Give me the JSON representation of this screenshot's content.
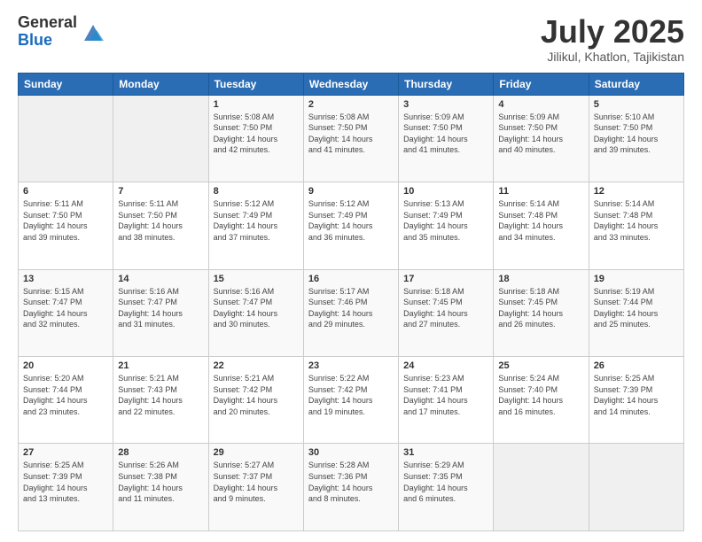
{
  "logo": {
    "general": "General",
    "blue": "Blue"
  },
  "title": "July 2025",
  "location": "Jilikul, Khatlon, Tajikistan",
  "days_header": [
    "Sunday",
    "Monday",
    "Tuesday",
    "Wednesday",
    "Thursday",
    "Friday",
    "Saturday"
  ],
  "weeks": [
    [
      {
        "day": "",
        "info": ""
      },
      {
        "day": "",
        "info": ""
      },
      {
        "day": "1",
        "info": "Sunrise: 5:08 AM\nSunset: 7:50 PM\nDaylight: 14 hours\nand 42 minutes."
      },
      {
        "day": "2",
        "info": "Sunrise: 5:08 AM\nSunset: 7:50 PM\nDaylight: 14 hours\nand 41 minutes."
      },
      {
        "day": "3",
        "info": "Sunrise: 5:09 AM\nSunset: 7:50 PM\nDaylight: 14 hours\nand 41 minutes."
      },
      {
        "day": "4",
        "info": "Sunrise: 5:09 AM\nSunset: 7:50 PM\nDaylight: 14 hours\nand 40 minutes."
      },
      {
        "day": "5",
        "info": "Sunrise: 5:10 AM\nSunset: 7:50 PM\nDaylight: 14 hours\nand 39 minutes."
      }
    ],
    [
      {
        "day": "6",
        "info": "Sunrise: 5:11 AM\nSunset: 7:50 PM\nDaylight: 14 hours\nand 39 minutes."
      },
      {
        "day": "7",
        "info": "Sunrise: 5:11 AM\nSunset: 7:50 PM\nDaylight: 14 hours\nand 38 minutes."
      },
      {
        "day": "8",
        "info": "Sunrise: 5:12 AM\nSunset: 7:49 PM\nDaylight: 14 hours\nand 37 minutes."
      },
      {
        "day": "9",
        "info": "Sunrise: 5:12 AM\nSunset: 7:49 PM\nDaylight: 14 hours\nand 36 minutes."
      },
      {
        "day": "10",
        "info": "Sunrise: 5:13 AM\nSunset: 7:49 PM\nDaylight: 14 hours\nand 35 minutes."
      },
      {
        "day": "11",
        "info": "Sunrise: 5:14 AM\nSunset: 7:48 PM\nDaylight: 14 hours\nand 34 minutes."
      },
      {
        "day": "12",
        "info": "Sunrise: 5:14 AM\nSunset: 7:48 PM\nDaylight: 14 hours\nand 33 minutes."
      }
    ],
    [
      {
        "day": "13",
        "info": "Sunrise: 5:15 AM\nSunset: 7:47 PM\nDaylight: 14 hours\nand 32 minutes."
      },
      {
        "day": "14",
        "info": "Sunrise: 5:16 AM\nSunset: 7:47 PM\nDaylight: 14 hours\nand 31 minutes."
      },
      {
        "day": "15",
        "info": "Sunrise: 5:16 AM\nSunset: 7:47 PM\nDaylight: 14 hours\nand 30 minutes."
      },
      {
        "day": "16",
        "info": "Sunrise: 5:17 AM\nSunset: 7:46 PM\nDaylight: 14 hours\nand 29 minutes."
      },
      {
        "day": "17",
        "info": "Sunrise: 5:18 AM\nSunset: 7:45 PM\nDaylight: 14 hours\nand 27 minutes."
      },
      {
        "day": "18",
        "info": "Sunrise: 5:18 AM\nSunset: 7:45 PM\nDaylight: 14 hours\nand 26 minutes."
      },
      {
        "day": "19",
        "info": "Sunrise: 5:19 AM\nSunset: 7:44 PM\nDaylight: 14 hours\nand 25 minutes."
      }
    ],
    [
      {
        "day": "20",
        "info": "Sunrise: 5:20 AM\nSunset: 7:44 PM\nDaylight: 14 hours\nand 23 minutes."
      },
      {
        "day": "21",
        "info": "Sunrise: 5:21 AM\nSunset: 7:43 PM\nDaylight: 14 hours\nand 22 minutes."
      },
      {
        "day": "22",
        "info": "Sunrise: 5:21 AM\nSunset: 7:42 PM\nDaylight: 14 hours\nand 20 minutes."
      },
      {
        "day": "23",
        "info": "Sunrise: 5:22 AM\nSunset: 7:42 PM\nDaylight: 14 hours\nand 19 minutes."
      },
      {
        "day": "24",
        "info": "Sunrise: 5:23 AM\nSunset: 7:41 PM\nDaylight: 14 hours\nand 17 minutes."
      },
      {
        "day": "25",
        "info": "Sunrise: 5:24 AM\nSunset: 7:40 PM\nDaylight: 14 hours\nand 16 minutes."
      },
      {
        "day": "26",
        "info": "Sunrise: 5:25 AM\nSunset: 7:39 PM\nDaylight: 14 hours\nand 14 minutes."
      }
    ],
    [
      {
        "day": "27",
        "info": "Sunrise: 5:25 AM\nSunset: 7:39 PM\nDaylight: 14 hours\nand 13 minutes."
      },
      {
        "day": "28",
        "info": "Sunrise: 5:26 AM\nSunset: 7:38 PM\nDaylight: 14 hours\nand 11 minutes."
      },
      {
        "day": "29",
        "info": "Sunrise: 5:27 AM\nSunset: 7:37 PM\nDaylight: 14 hours\nand 9 minutes."
      },
      {
        "day": "30",
        "info": "Sunrise: 5:28 AM\nSunset: 7:36 PM\nDaylight: 14 hours\nand 8 minutes."
      },
      {
        "day": "31",
        "info": "Sunrise: 5:29 AM\nSunset: 7:35 PM\nDaylight: 14 hours\nand 6 minutes."
      },
      {
        "day": "",
        "info": ""
      },
      {
        "day": "",
        "info": ""
      }
    ]
  ]
}
